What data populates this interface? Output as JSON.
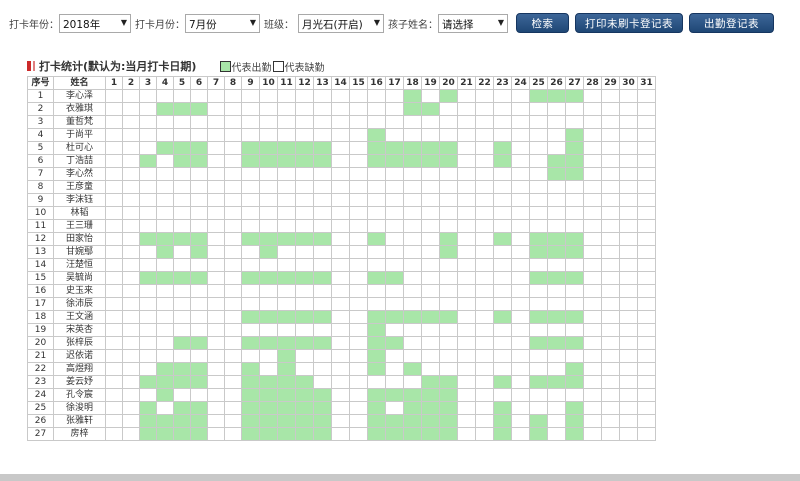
{
  "filters": {
    "year_label": "打卡年份：",
    "year_value": "2018年",
    "month_label": "打卡月份：",
    "month_value": "7月份",
    "class_label": "班级：",
    "class_value": "月光石(开启)",
    "child_label": "孩子姓名：",
    "child_value": "请选择"
  },
  "buttons": {
    "search": "检索",
    "print_missing": "打印未刷卡登记表",
    "attendance": "出勤登记表"
  },
  "section": {
    "title": "打卡统计(默认为:当月打卡日期)",
    "legend_present": "代表出勤",
    "legend_absent": "代表缺勤"
  },
  "table": {
    "header_index": "序号",
    "header_name": "姓名",
    "days": [
      "1",
      "2",
      "3",
      "4",
      "5",
      "6",
      "7",
      "8",
      "9",
      "10",
      "11",
      "12",
      "13",
      "14",
      "15",
      "16",
      "17",
      "18",
      "19",
      "20",
      "21",
      "22",
      "23",
      "24",
      "25",
      "26",
      "27",
      "28",
      "29",
      "30",
      "31"
    ],
    "rows": [
      {
        "index": "1",
        "name": "李心泽",
        "present": [
          18,
          20,
          25,
          26,
          27
        ]
      },
      {
        "index": "2",
        "name": "衣雅琪",
        "present": [
          4,
          5,
          6,
          18,
          19
        ]
      },
      {
        "index": "3",
        "name": "董哲梵",
        "present": []
      },
      {
        "index": "4",
        "name": "于尚平",
        "present": [
          16,
          27
        ]
      },
      {
        "index": "5",
        "name": "杜可心",
        "present": [
          4,
          5,
          6,
          9,
          10,
          11,
          12,
          13,
          16,
          17,
          18,
          19,
          20,
          23,
          27
        ]
      },
      {
        "index": "6",
        "name": "丁浩喆",
        "present": [
          3,
          5,
          6,
          9,
          10,
          11,
          12,
          13,
          16,
          17,
          18,
          19,
          20,
          23,
          26,
          27
        ]
      },
      {
        "index": "7",
        "name": "李心然",
        "present": [
          26,
          27
        ]
      },
      {
        "index": "8",
        "name": "王彦童",
        "present": []
      },
      {
        "index": "9",
        "name": "李沫钰",
        "present": []
      },
      {
        "index": "10",
        "name": "林韬",
        "present": []
      },
      {
        "index": "11",
        "name": "王三珊",
        "present": []
      },
      {
        "index": "12",
        "name": "田家怡",
        "present": [
          3,
          4,
          5,
          6,
          9,
          10,
          11,
          12,
          13,
          16,
          20,
          23,
          25,
          26,
          27
        ]
      },
      {
        "index": "13",
        "name": "甘婉鄢",
        "present": [
          4,
          6,
          10,
          20,
          25,
          26,
          27
        ]
      },
      {
        "index": "14",
        "name": "汪楚恒",
        "present": []
      },
      {
        "index": "15",
        "name": "吴毓尚",
        "present": [
          3,
          4,
          5,
          6,
          9,
          10,
          11,
          12,
          13,
          16,
          17,
          25,
          26,
          27
        ]
      },
      {
        "index": "16",
        "name": "史玉来",
        "present": []
      },
      {
        "index": "17",
        "name": "徐沛辰",
        "present": []
      },
      {
        "index": "18",
        "name": "王文涵",
        "present": [
          9,
          10,
          11,
          12,
          13,
          16,
          17,
          18,
          19,
          20,
          23,
          25,
          26,
          27
        ]
      },
      {
        "index": "19",
        "name": "宋英杏",
        "present": [
          16
        ]
      },
      {
        "index": "20",
        "name": "张梓辰",
        "present": [
          5,
          6,
          9,
          10,
          11,
          12,
          13,
          16,
          17,
          25,
          26,
          27
        ]
      },
      {
        "index": "21",
        "name": "迟依诺",
        "present": [
          11,
          16
        ]
      },
      {
        "index": "22",
        "name": "高煜翔",
        "present": [
          4,
          5,
          6,
          9,
          11,
          16,
          18,
          27
        ]
      },
      {
        "index": "23",
        "name": "姜云妤",
        "present": [
          3,
          4,
          5,
          6,
          9,
          10,
          11,
          12,
          19,
          20,
          23,
          25,
          26,
          27
        ]
      },
      {
        "index": "24",
        "name": "孔令宸",
        "present": [
          4,
          9,
          10,
          11,
          12,
          13,
          16,
          17,
          18,
          19,
          20
        ]
      },
      {
        "index": "25",
        "name": "徐浚明",
        "present": [
          3,
          5,
          6,
          9,
          10,
          11,
          12,
          13,
          16,
          18,
          19,
          20,
          23,
          27
        ]
      },
      {
        "index": "26",
        "name": "张雅轩",
        "present": [
          3,
          4,
          5,
          6,
          9,
          10,
          11,
          12,
          13,
          16,
          17,
          18,
          19,
          20,
          23,
          25,
          27
        ]
      },
      {
        "index": "27",
        "name": "房梓",
        "present": [
          3,
          4,
          5,
          6,
          9,
          10,
          11,
          12,
          13,
          16,
          17,
          18,
          19,
          20,
          23,
          25,
          27
        ]
      }
    ]
  },
  "colors": {
    "present": "#a8e6a8",
    "button_bg": "#2b5586",
    "title_mark": "#cc2a2a"
  }
}
